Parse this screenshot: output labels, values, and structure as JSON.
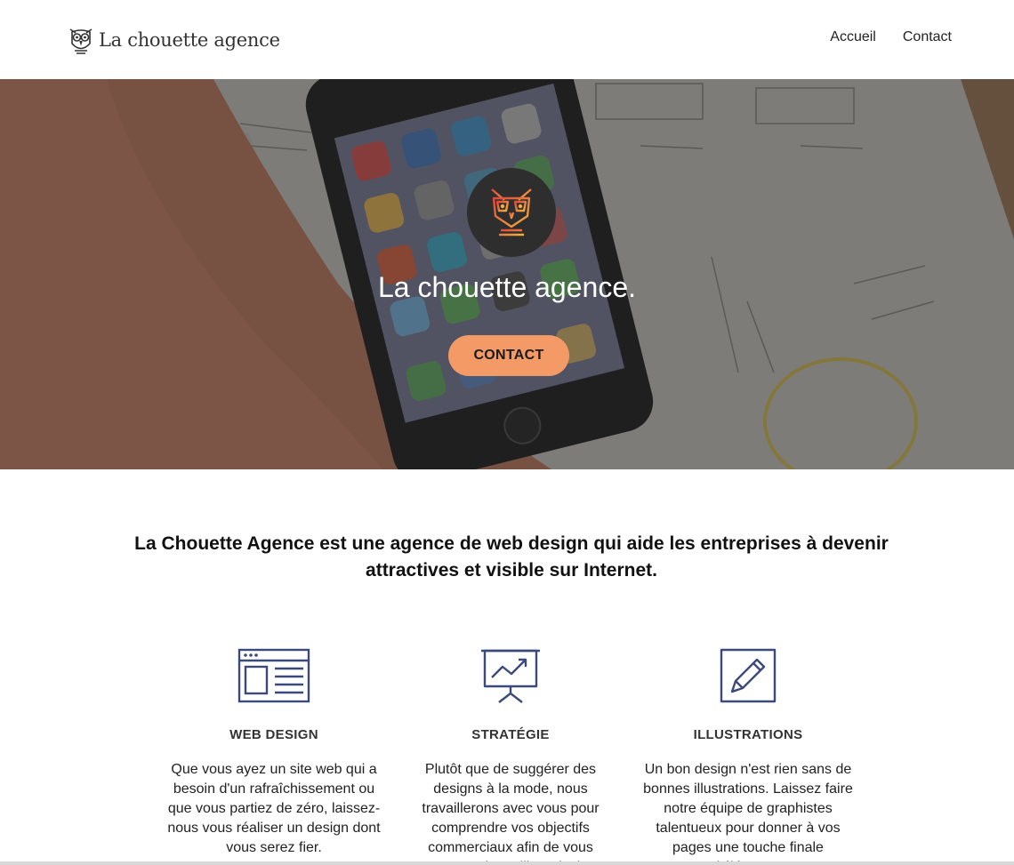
{
  "brand": {
    "name": "La chouette agence",
    "logo_icon": "owl-icon"
  },
  "nav": {
    "items": [
      "Accueil",
      "Contact"
    ]
  },
  "hero": {
    "badge_icon": "owl-icon",
    "title": "La chouette agence.",
    "cta_label": "CONTACT",
    "cta_color": "#f39a67"
  },
  "intro": {
    "text": "La Chouette Agence est une agence de web design qui aide les entreprises à devenir attractives et visible sur Internet."
  },
  "services": [
    {
      "icon": "browser-window-icon",
      "title": "WEB DESIGN",
      "text": "Que vous ayez un site web qui a besoin d'un rafraîchissement ou que vous partiez de zéro, laissez-nous vous réaliser un design dont vous serez fier."
    },
    {
      "icon": "presentation-chart-icon",
      "title": "STRATÉGIE",
      "text": "Plutôt que de suggérer des designs à la mode, nous travaillerons avec vous pour comprendre vos objectifs commerciaux afin de vous proposer le meilleur design"
    },
    {
      "icon": "pencil-icon",
      "title": "ILLUSTRATIONS",
      "text": "Un bon design n'est rien sans de bonnes illustrations. Laissez faire notre équipe de graphistes talentueux pour donner à vos pages une touche finale d'élégance."
    }
  ]
}
